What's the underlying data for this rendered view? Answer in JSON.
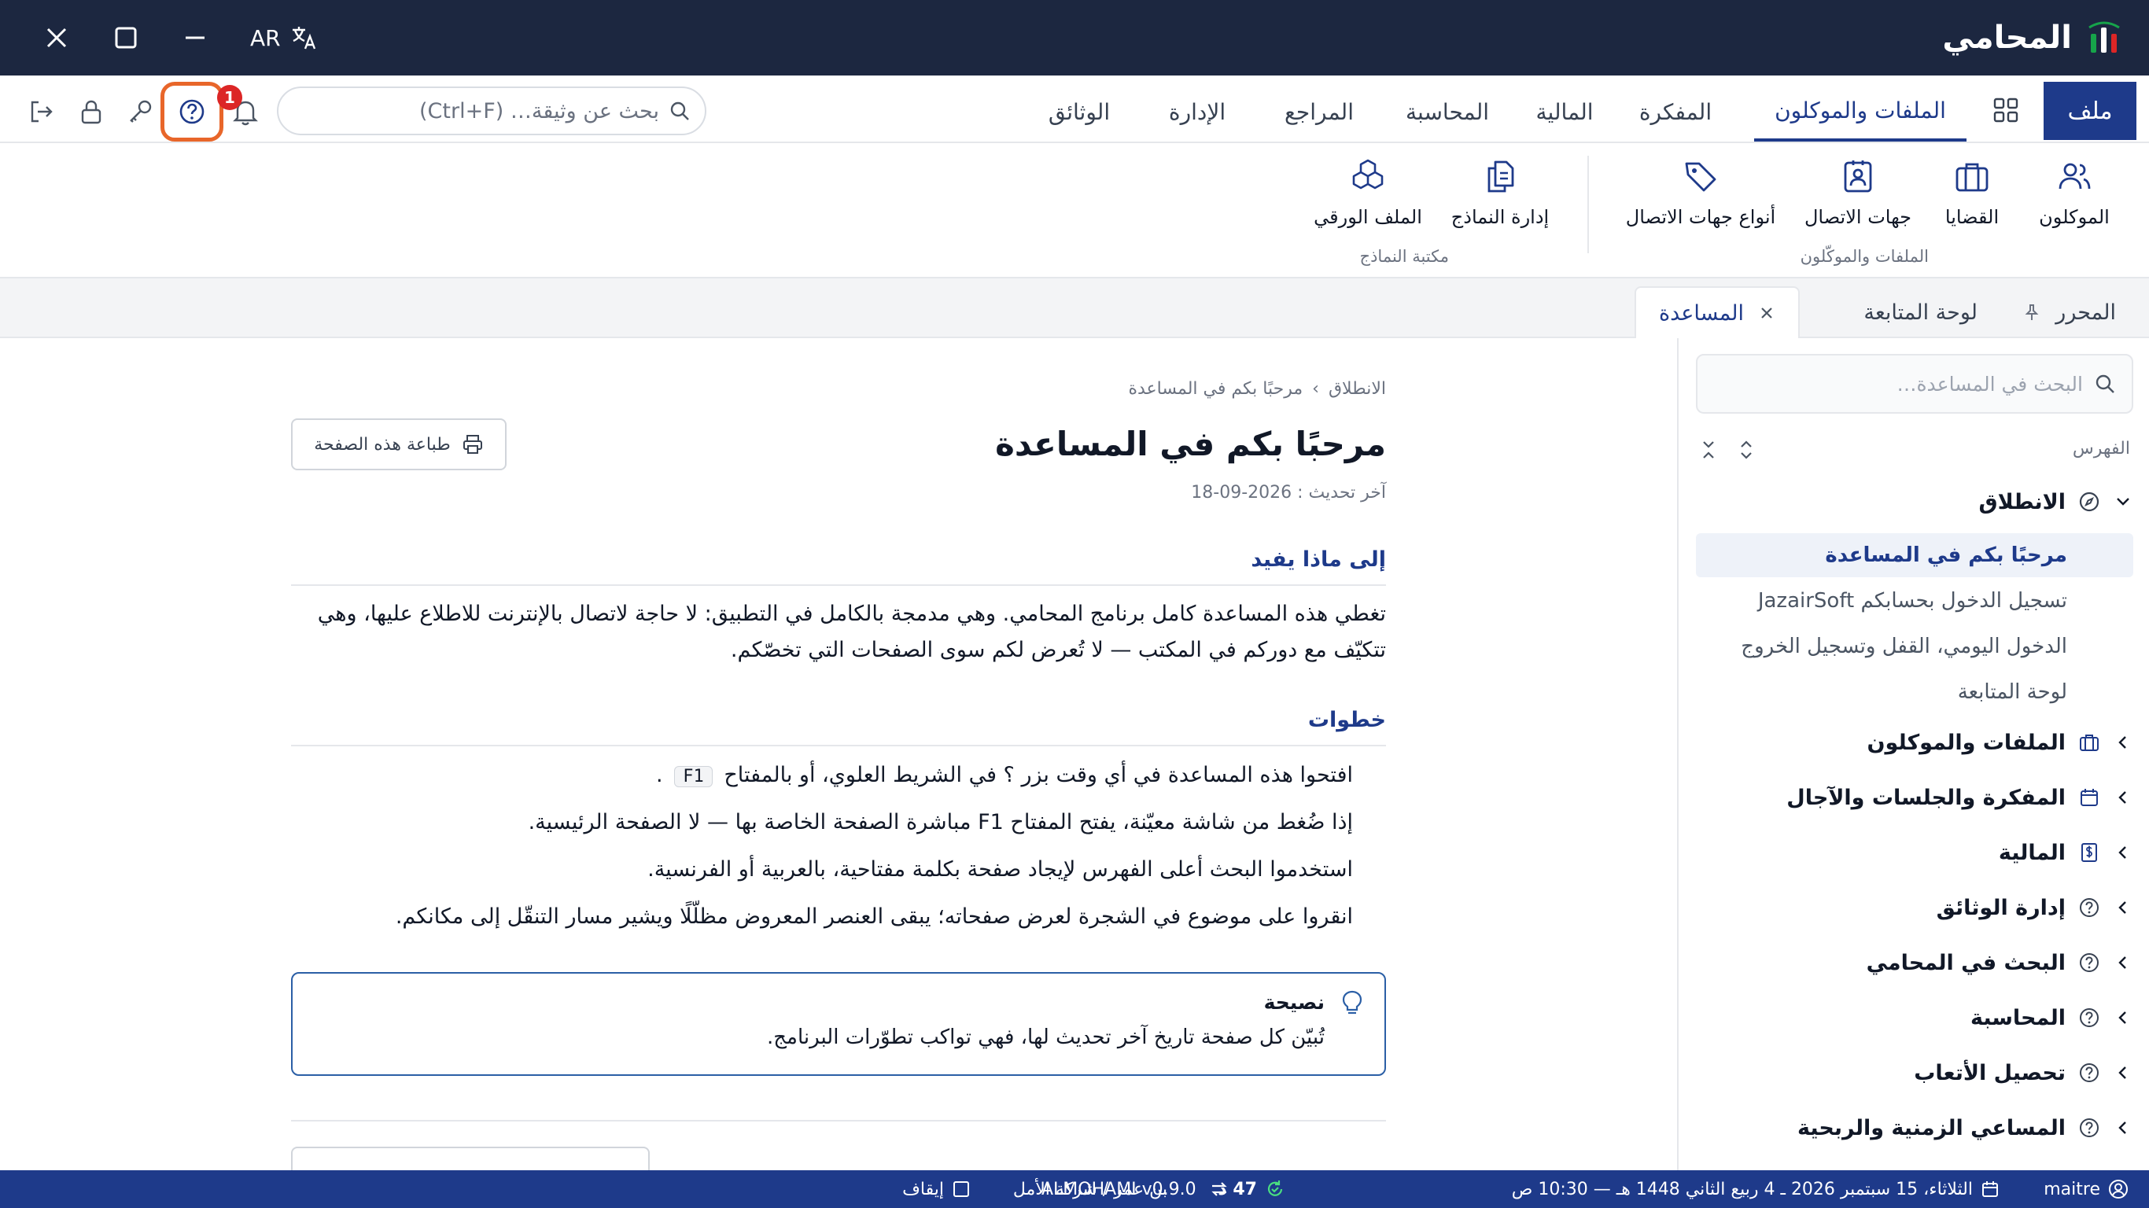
{
  "titlebar": {
    "app_name": "المحامي",
    "language": "AR",
    "icons": [
      "logo-icon",
      "translate-icon",
      "close-icon",
      "maximize-icon",
      "minimize-icon"
    ]
  },
  "navbar": {
    "file_menu": "ملف",
    "tabs": [
      "الملفات والموكلون",
      "المفكرة",
      "المالية",
      "المحاسبة",
      "المراجع",
      "الإدارة",
      "الوثائق"
    ],
    "active_tab": "الملفات والموكلون",
    "search_placeholder": "بحث عن وثيقة… (Ctrl+F)",
    "notification_count": "1",
    "tool_icons": [
      "logout-icon",
      "lock-icon",
      "key-icon",
      "help-icon",
      "bell-icon",
      "grid-icon"
    ]
  },
  "ribbon": {
    "groups": [
      {
        "label": "الملفات والموكّلون",
        "items": [
          "الموكلون",
          "القضايا",
          "جهات الاتصال",
          "أنواع جهات الاتصال"
        ]
      },
      {
        "label": "مكتبة النماذج",
        "items": [
          "إدارة النماذج",
          "الملف الورقي"
        ]
      }
    ]
  },
  "doc_tabs": {
    "editor": "المحرر",
    "dashboard": "لوحة المتابعة",
    "help": "المساعدة"
  },
  "sidebar": {
    "search_placeholder": "البحث في المساعدة…",
    "toc_label": "الفهرس",
    "sections": [
      {
        "label": "الانطلاق",
        "icon": "compass-icon",
        "expanded": true,
        "children": [
          "مرحبًا بكم في المساعدة",
          "تسجيل الدخول بحسابكم JazairSoft",
          "الدخول اليومي، القفل وتسجيل الخروج",
          "لوحة المتابعة"
        ]
      },
      {
        "label": "الملفات والموكلون",
        "icon": "briefcase-icon"
      },
      {
        "label": "المفكرة والجلسات والآجال",
        "icon": "calendar-icon"
      },
      {
        "label": "المالية",
        "icon": "dollar-icon"
      },
      {
        "label": "إدارة الوثائق",
        "icon": "help-circle-icon"
      },
      {
        "label": "البحث في المحامي",
        "icon": "help-circle-icon"
      },
      {
        "label": "المحاسبة",
        "icon": "help-circle-icon"
      },
      {
        "label": "تحصيل الأتعاب",
        "icon": "help-circle-icon"
      },
      {
        "label": "المساعي الزمنية والربحية",
        "icon": "help-circle-icon"
      }
    ],
    "active_item": "مرحبًا بكم في المساعدة"
  },
  "main": {
    "breadcrumb": [
      "الانطلاق",
      "مرحبًا بكم في المساعدة"
    ],
    "breadcrumb_sep": "›",
    "title": "مرحبًا بكم في المساعدة",
    "last_updated": "آخر تحديث : 2026-09-18",
    "print_label": "طباعة هذه الصفحة",
    "section1_title": "إلى ماذا يفيد",
    "section1_text": "تغطي هذه المساعدة كامل برنامج المحامي. وهي مدمجة بالكامل في التطبيق: لا حاجة لاتصال بالإنترنت للاطلاع عليها، وهي تتكيّف مع دوركم في المكتب — لا تُعرض لكم سوى الصفحات التي تخصّكم.",
    "section2_title": "خطوات",
    "step1_a": "افتحوا هذه المساعدة في أي وقت بزر ؟ في الشريط العلوي، أو بالمفتاح",
    "step1_key": "F1",
    "step1_b": ".",
    "step2": "إذا ضُغط من شاشة معيّنة، يفتح المفتاح F1 مباشرة الصفحة الخاصة بها — لا الصفحة الرئيسية.",
    "step3": "استخدموا البحث أعلى الفهرس لإيجاد صفحة بكلمة مفتاحية، بالعربية أو الفرنسية.",
    "step4": "انقروا على موضوع في الشجرة لعرض صفحاته؛ يبقى العنصر المعروض مظلّلًا ويشير مسار التنقّل إلى مكانكم.",
    "tip_title": "نصيحة",
    "tip_text": "تُبيّن كل صفحة تاريخ آخر تحديث لها، فهي تواكب تطوّرات البرنامج."
  },
  "statusbar": {
    "user": "maitre",
    "date": "الثلاثاء، 15 سبتمبر 2026 ـ 4 ربيع الثاني 1448 هـ — 10:30 ص",
    "sync_count": "47 د",
    "office": "بن عمر / شركة الأمل",
    "pause_label": "إيقاف",
    "version": "ALMOHAMI v0.9.0"
  },
  "colors": {
    "titlebar": "#1c2740",
    "primary": "#1e3a8a",
    "highlight": "#e8662a",
    "badge": "#dc2626",
    "active_bg": "#eef2f9"
  }
}
